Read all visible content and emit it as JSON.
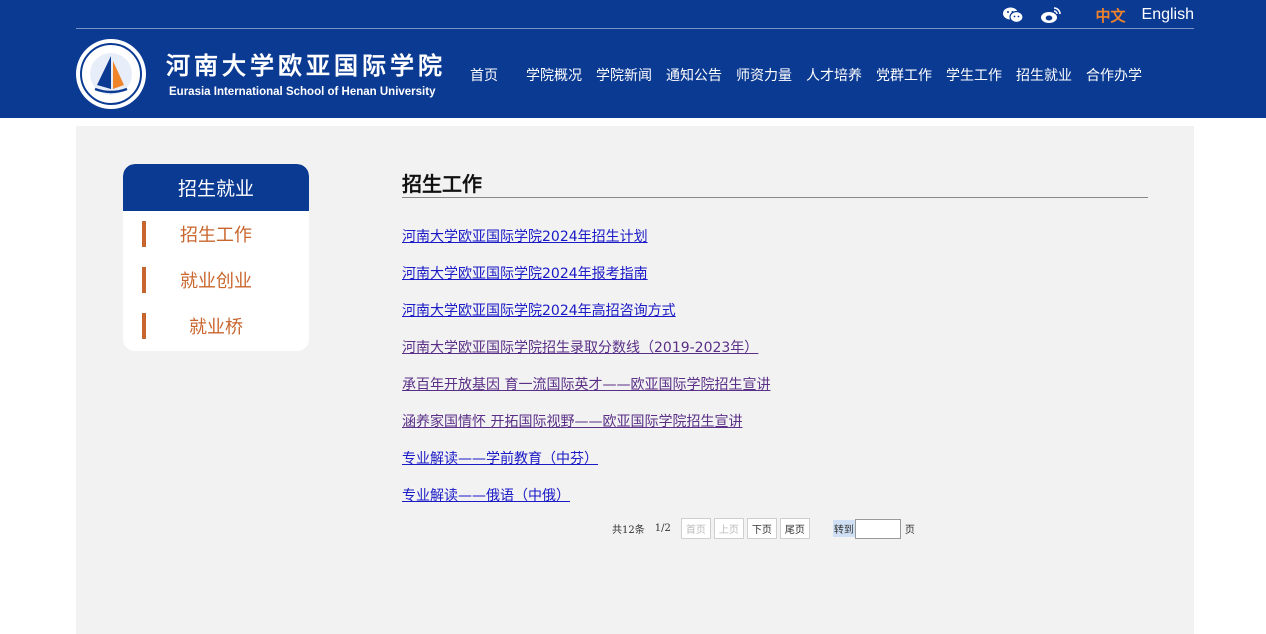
{
  "header": {
    "school_name_cn": "河南大学欧亚国际学院",
    "school_name_en": "Eurasia International School of Henan University",
    "lang_cn": "中文",
    "lang_en": "English",
    "social_icons": [
      "wechat-icon",
      "weibo-icon"
    ],
    "nav": [
      "首页",
      "学院概况",
      "学院新闻",
      "通知公告",
      "师资力量",
      "人才培养",
      "党群工作",
      "学生工作",
      "招生就业",
      "合作办学"
    ]
  },
  "sidebar": {
    "title": "招生就业",
    "items": [
      "招生工作",
      "就业创业",
      "就业桥"
    ]
  },
  "main": {
    "title": "招生工作",
    "news": [
      "河南大学欧亚国际学院2024年招生计划",
      "河南大学欧亚国际学院2024年报考指南",
      "河南大学欧亚国际学院2024年高招咨询方式",
      "河南大学欧亚国际学院招生录取分数线（2019-2023年）",
      "承百年开放基因 育一流国际英才——欧亚国际学院招生宣讲",
      "涵养家国情怀 开拓国际视野——欧亚国际学院招生宣讲",
      "专业解读——学前教育（中芬）",
      "专业解读——俄语（中俄）"
    ]
  },
  "pager": {
    "total": "共12条",
    "page": "1/2",
    "first": "首页",
    "prev": "上页",
    "next": "下页",
    "last": "尾页",
    "goto": "转到",
    "page_unit": "页"
  },
  "colors": {
    "brand_blue": "#0b3a93",
    "accent_orange": "#c9662e",
    "link_blue": "#1a1ac6"
  }
}
